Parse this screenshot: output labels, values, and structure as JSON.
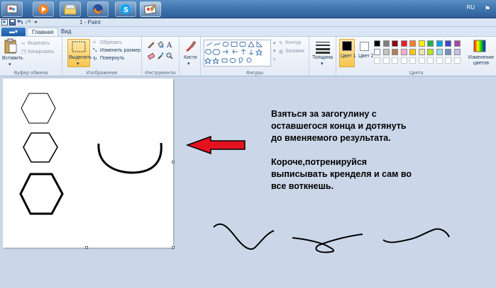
{
  "taskbar": {
    "language": "RU",
    "apps": [
      "paint-icon",
      "media-player-icon",
      "folder-icon",
      "firefox-icon",
      "skype-icon",
      "paint-active-icon"
    ]
  },
  "window": {
    "title": "1 - Paint"
  },
  "tabs": {
    "file": "▬▾",
    "home": "Главная",
    "view": "Вид"
  },
  "ribbon": {
    "clipboard": {
      "paste": "Вставить",
      "cut": "Вырезать",
      "copy": "Копировать",
      "label": "Буфер обмена"
    },
    "image": {
      "select": "Выделить",
      "crop": "Обрезать",
      "resize": "Изменить размер",
      "rotate": "Повернуть",
      "label": "Изображение"
    },
    "tools": {
      "label": "Инструменты"
    },
    "brushes": {
      "label": "Кисти"
    },
    "shapes": {
      "outline": "Контур",
      "fill": "Заливка",
      "label": "Фигуры"
    },
    "size": {
      "label": "Толщина"
    },
    "colors": {
      "color1": "Цвет 1",
      "color2": "Цвет 2",
      "edit": "Изменение цветов",
      "label": "Цвета",
      "color1_value": "#000000",
      "color2_value": "#ffffff",
      "palette_row1": [
        "#000000",
        "#7f7f7f",
        "#880015",
        "#ed1c24",
        "#ff7f27",
        "#fff200",
        "#22b14c",
        "#00a2e8",
        "#3f48cc",
        "#a349a4"
      ],
      "palette_row2": [
        "#ffffff",
        "#c3c3c3",
        "#b97a57",
        "#ffaec9",
        "#ffc90e",
        "#efe4b0",
        "#b5e61d",
        "#99d9ea",
        "#7092be",
        "#c8bfe7"
      ]
    }
  },
  "note": {
    "line1": "Взяться за загогулину с",
    "line2": "оставшегося конца и дотянуть",
    "line3": "до вменяемого результата.",
    "line4": "Короче,потренируйся",
    "line5": "выписывать кренделя и сам во",
    "line6": "все воткнешь."
  }
}
